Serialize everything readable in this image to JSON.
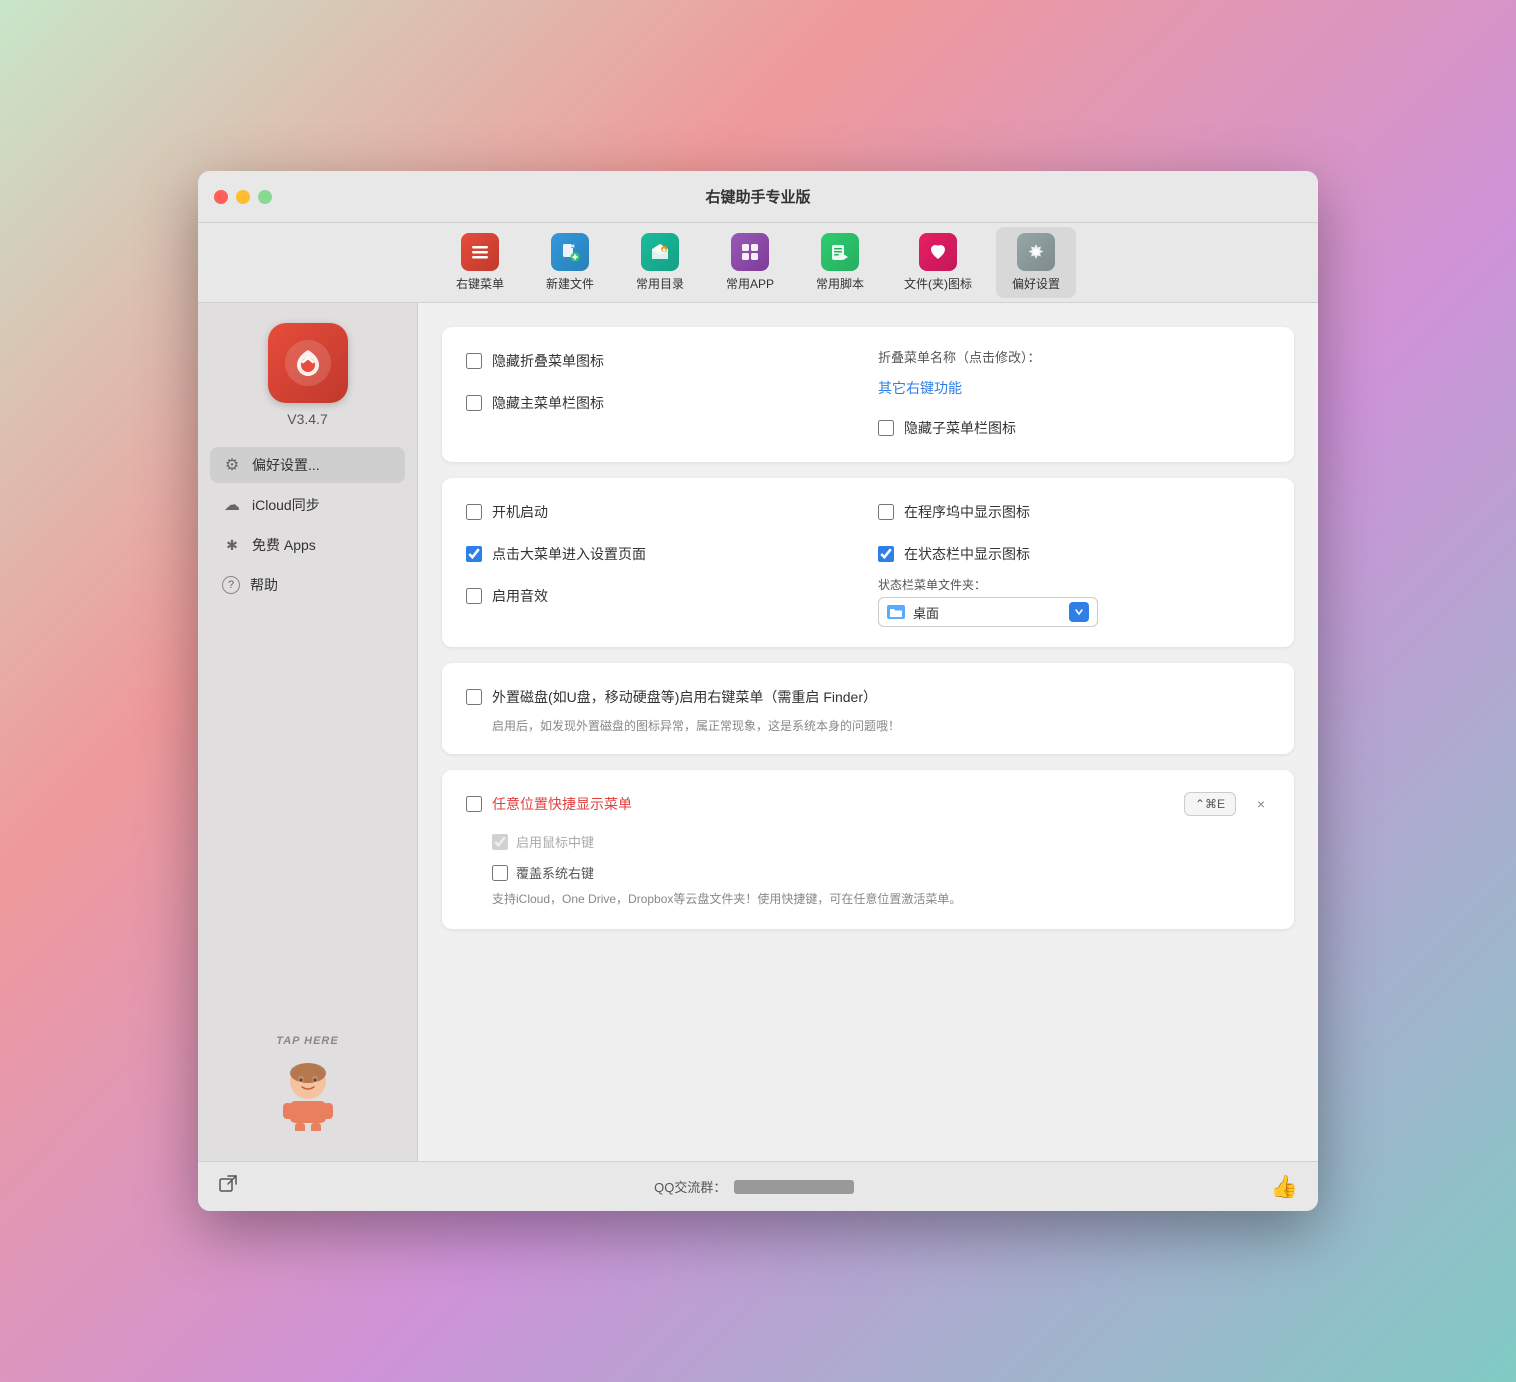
{
  "window": {
    "title": "右键助手专业版"
  },
  "titlebar": {
    "title": "右键助手专业版"
  },
  "toolbar": {
    "items": [
      {
        "id": "context-menu",
        "label": "右键菜单",
        "icon": "≡",
        "bg": "icon-bg-red",
        "active": false
      },
      {
        "id": "new-file",
        "label": "新建文件",
        "icon": "+",
        "bg": "icon-bg-blue",
        "active": false
      },
      {
        "id": "common-dir",
        "label": "常用目录",
        "icon": "★",
        "bg": "icon-bg-teal",
        "active": false
      },
      {
        "id": "common-app",
        "label": "常用APP",
        "icon": "⚙",
        "bg": "icon-bg-purple",
        "active": false
      },
      {
        "id": "common-script",
        "label": "常用脚本",
        "icon": "▶",
        "bg": "icon-bg-green",
        "active": false
      },
      {
        "id": "file-icon",
        "label": "文件(夹)图标",
        "icon": "♥",
        "bg": "icon-bg-pink",
        "active": false
      },
      {
        "id": "preferences",
        "label": "偏好设置",
        "icon": "⚙",
        "bg": "icon-bg-gray",
        "active": true
      }
    ]
  },
  "sidebar": {
    "app_version": "V3.4.7",
    "nav_items": [
      {
        "id": "preferences",
        "label": "偏好设置...",
        "icon": "⚙",
        "active": true
      },
      {
        "id": "icloud",
        "label": "iCloud同步",
        "icon": "☁",
        "active": false
      },
      {
        "id": "free-apps",
        "label": "免费 Apps",
        "icon": "✱",
        "active": false
      },
      {
        "id": "help",
        "label": "帮助",
        "icon": "?",
        "active": false
      }
    ],
    "tap_here": "TAP HERE"
  },
  "content": {
    "card1": {
      "hide_fold_icon_label": "隐藏折叠菜单图标",
      "hide_menubar_icon_label": "隐藏主菜单栏图标",
      "fold_menu_name_label": "折叠菜单名称（点击修改）：",
      "fold_menu_name_value": "其它右键功能",
      "hide_submenubar_icon_label": "隐藏子菜单栏图标"
    },
    "card2": {
      "startup_label": "开机启动",
      "show_in_dock_label": "在程序坞中显示图标",
      "click_to_settings_label": "点击大菜单进入设置页面",
      "show_in_statusbar_label": "在状态栏中显示图标",
      "enable_sound_label": "启用音效",
      "statusbar_folder_label": "状态栏菜单文件夹：",
      "folder_name": "桌面",
      "click_to_settings_checked": true,
      "show_in_statusbar_checked": true
    },
    "card3": {
      "ext_drive_label": "外置磁盘(如U盘，移动硬盘等)启用右键菜单（需重启 Finder）",
      "ext_drive_sub": "启用后，如发现外置磁盘的图标异常，属正常现象，这是系统本身的问题哦！"
    },
    "card4": {
      "quick_menu_label": "任意位置快捷显示菜单",
      "shortcut_text": "⌃⌘E",
      "enable_middle_click_label": "启用鼠标中键",
      "cover_right_click_label": "覆盖系统右键",
      "desc": "支持iCloud，One Drive，Dropbox等云盘文件夹！使用快捷键，可在任意位置激活菜单。"
    }
  },
  "footer": {
    "qq_label": "QQ交流群：",
    "qq_number": "████████████"
  }
}
